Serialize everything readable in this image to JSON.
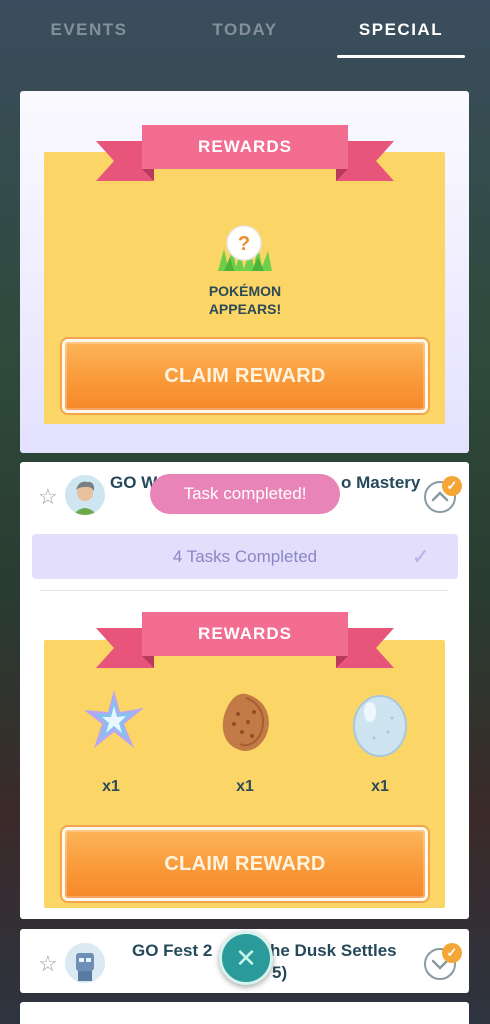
{
  "tabs": [
    {
      "label": "EVENTS"
    },
    {
      "label": "TODAY"
    },
    {
      "label": "SPECIAL"
    }
  ],
  "active_tab": "SPECIAL",
  "top_card": {
    "rewards_label": "REWARDS",
    "reward_text_line1": "POKÉMON",
    "reward_text_line2": "APPEARS!",
    "mystery_icon": "question-mark-in-grass-icon",
    "claim_label": "CLAIM REWARD"
  },
  "quest_card": {
    "title": "GO W",
    "title_tail": "o Mastery",
    "toast": "Task completed!",
    "tasks_completed": "4 Tasks Completed",
    "rewards_label": "REWARDS",
    "items": [
      {
        "icon": "star-piece-icon",
        "qty": "x1"
      },
      {
        "icon": "sinnoh-stone-icon",
        "qty": "x1"
      },
      {
        "icon": "pokemon-egg-icon",
        "qty": "x1"
      }
    ],
    "claim_label": "CLAIM REWARD"
  },
  "next_card": {
    "title_start": "GO Fest 2",
    "title_end": "he Dusk Settles",
    "subtitle_tail": "5)"
  },
  "colors": {
    "accent_pink": "#f26d8f",
    "reward_yellow": "#fbd566",
    "claim_orange": "#f99a3a",
    "title_teal": "#25495a",
    "toast_pink": "#e884b8",
    "close_teal": "#2a9a9a"
  }
}
